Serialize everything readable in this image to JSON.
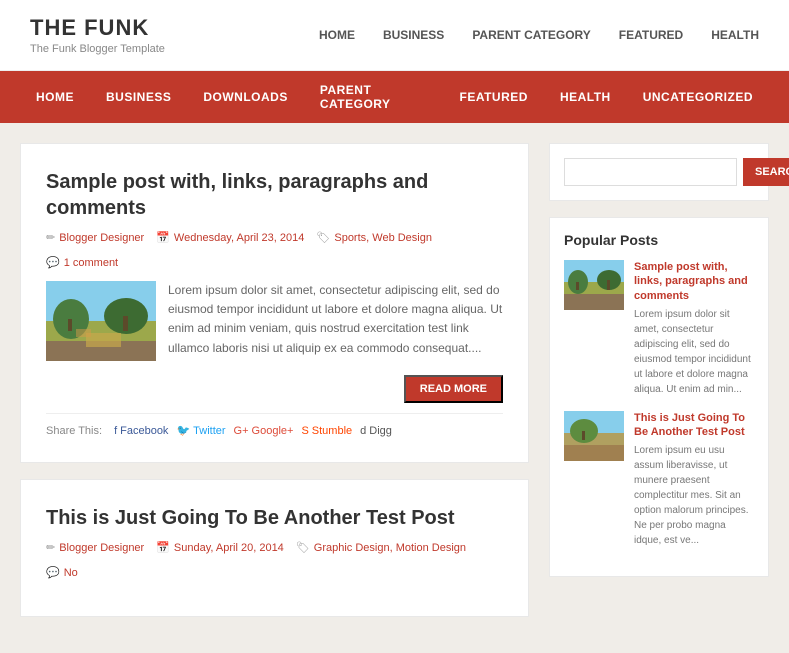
{
  "site": {
    "title": "THE FUNK",
    "subtitle": "The Funk Blogger Template"
  },
  "top_nav": {
    "items": [
      "HOME",
      "BUSINESS",
      "PARENT CATEGORY",
      "FEATURED",
      "HEALTH"
    ]
  },
  "primary_nav": {
    "items": [
      "HOME",
      "BUSINESS",
      "DOWNLOADS",
      "PARENT CATEGORY",
      "FEATURED",
      "HEALTH",
      "UNCATEGORIZED"
    ]
  },
  "posts": [
    {
      "title": "Sample post with, links, paragraphs and comments",
      "author": "Blogger Designer",
      "date": "Wednesday, April 23, 2014",
      "categories": "Sports, Web Design",
      "comments": "1 comment",
      "excerpt": "Lorem ipsum dolor sit amet, consectetur adipiscing elit, sed do eiusmod tempor incididunt ut labore et dolore magna aliqua. Ut enim ad minim veniam, quis nostrud exercitation test link ullamco laboris nisi ut aliquip ex ea commodo consequat....",
      "read_more": "Read More",
      "share_label": "Share This:",
      "share_items": [
        "Facebook",
        "Twitter",
        "Google+",
        "Stumble",
        "Digg"
      ]
    },
    {
      "title": "This is Just Going To Be Another Test Post",
      "author": "Blogger Designer",
      "date": "Sunday, April 20, 2014",
      "categories": "Graphic Design, Motion Design",
      "comments": "No"
    }
  ],
  "sidebar": {
    "search_placeholder": "",
    "search_btn_label": "SEARCH",
    "popular_posts_title": "Popular Posts",
    "popular_posts": [
      {
        "title": "Sample post with, links, paragraphs and comments",
        "excerpt": "Lorem ipsum dolor sit amet, consectetur adipiscing elit, sed do eiusmod tempor incididunt ut labore et dolore magna aliqua. Ut enim ad min..."
      },
      {
        "title": "This is Just Going To Be Another Test Post",
        "excerpt": "Lorem ipsum eu usu assum liberavisse, ut munere praesent complectitur mes. Sit an option malorum principes. Ne per probo magna idque, est ve..."
      }
    ]
  }
}
